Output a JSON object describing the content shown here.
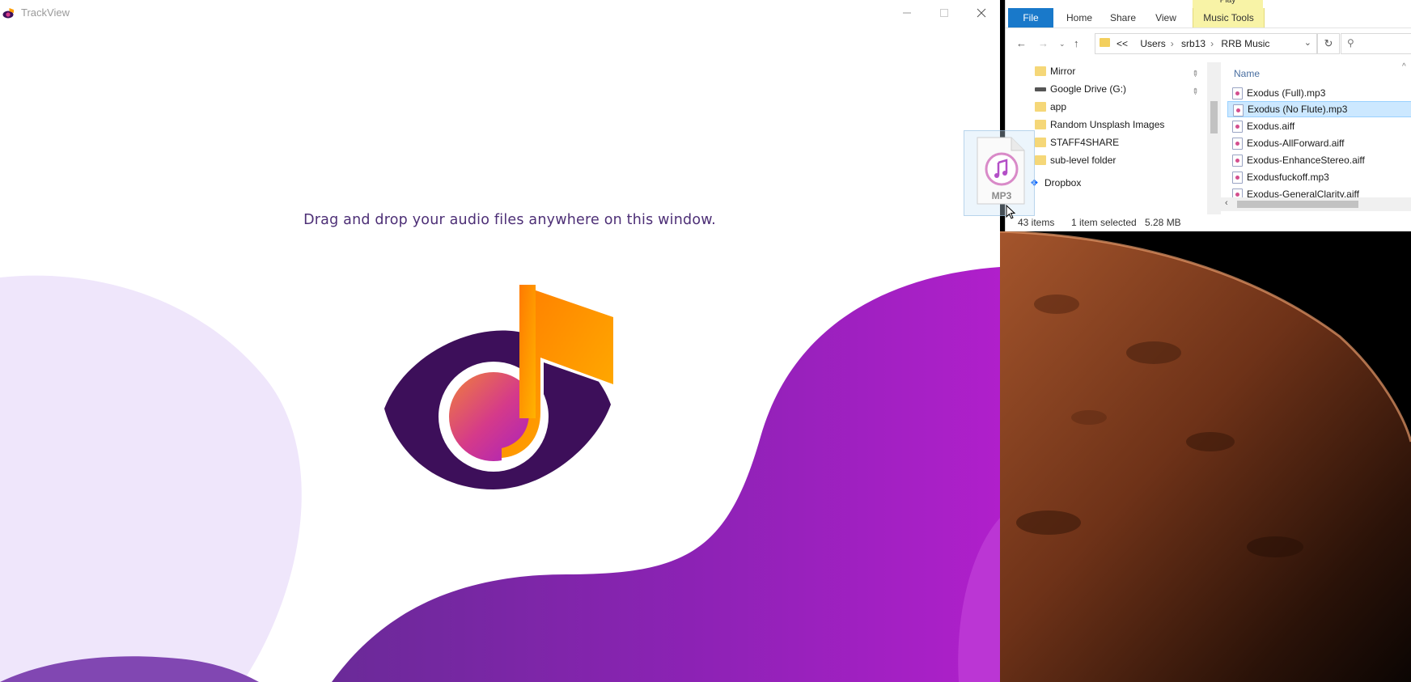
{
  "trackview": {
    "title": "TrackView",
    "drop_prompt": "Drag and drop your audio files anywhere on this window."
  },
  "explorer": {
    "context_tab_top": "Play",
    "ribbon": {
      "file": "File",
      "home": "Home",
      "share": "Share",
      "view": "View",
      "music_tools": "Music Tools"
    },
    "address": {
      "overflow": "<<",
      "crumbs": [
        "Users",
        "srb13",
        "RRB Music"
      ]
    },
    "nav_pane": [
      {
        "label": "Mirror",
        "icon": "folder-icon",
        "pinned": true
      },
      {
        "label": "Google Drive (G:)",
        "icon": "drive-icon",
        "pinned": true
      },
      {
        "label": "app",
        "icon": "folder-icon"
      },
      {
        "label": "Random Unsplash Images",
        "icon": "folder-icon"
      },
      {
        "label": "STAFF4SHARE",
        "icon": "folder-icon"
      },
      {
        "label": "sub-level folder",
        "icon": "folder-icon"
      },
      {
        "label": "Dropbox",
        "icon": "dropbox-icon"
      }
    ],
    "list": {
      "column_name": "Name",
      "files": [
        "Exodus (Full).mp3",
        "Exodus (No Flute).mp3",
        "Exodus.aiff",
        "Exodus-AllForward.aiff",
        "Exodus-EnhanceStereo.aiff",
        "Exodusfuckoff.mp3",
        "Exodus-GeneralClarity.aiff"
      ],
      "selected_index": 1
    },
    "status": {
      "count": "43 items",
      "selected": "1 item selected",
      "size": "5.28 MB"
    }
  },
  "drag_ghost": {
    "label": "MP3"
  },
  "colors": {
    "trackview_purple_dark": "#3d0f5a",
    "trackview_purple": "#a31fc4",
    "trackview_orange": "#ffa800",
    "explorer_file_tab": "#1979ca",
    "music_tools_tab": "#f8f3a6",
    "selection": "#cce8ff"
  }
}
